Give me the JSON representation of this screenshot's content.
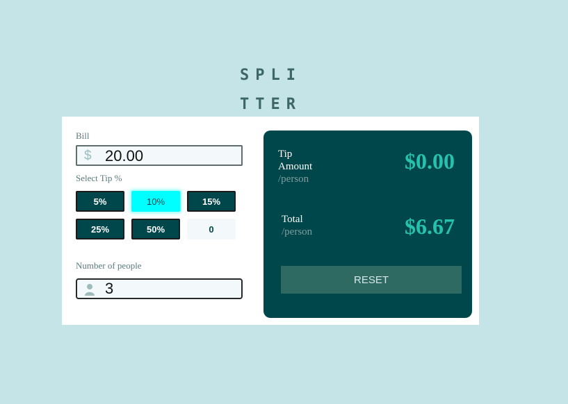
{
  "logo": {
    "line1": "SPLI",
    "line2": "TTER"
  },
  "bill": {
    "label": "Bill",
    "currency": "$",
    "value": "20.00"
  },
  "tip": {
    "label": "Select Tip %",
    "options": [
      "5%",
      "10%",
      "15%",
      "25%",
      "50%"
    ],
    "selected": "10%",
    "custom_value": "0"
  },
  "people": {
    "label": "Number of people",
    "value": "3",
    "icon": "person-icon"
  },
  "results": {
    "tip_title_line1": "Tip",
    "tip_title_line2": "Amount",
    "tip_per": "/person",
    "tip_amount": "$0.00",
    "total_title": "Total",
    "total_per": "/person",
    "total_amount": "$6.67",
    "reset_label": "RESET"
  },
  "colors": {
    "page_bg": "#c5e4e7",
    "panel_bg": "#00474b",
    "accent": "#26c2ae",
    "active_tip": "#00ffff"
  }
}
